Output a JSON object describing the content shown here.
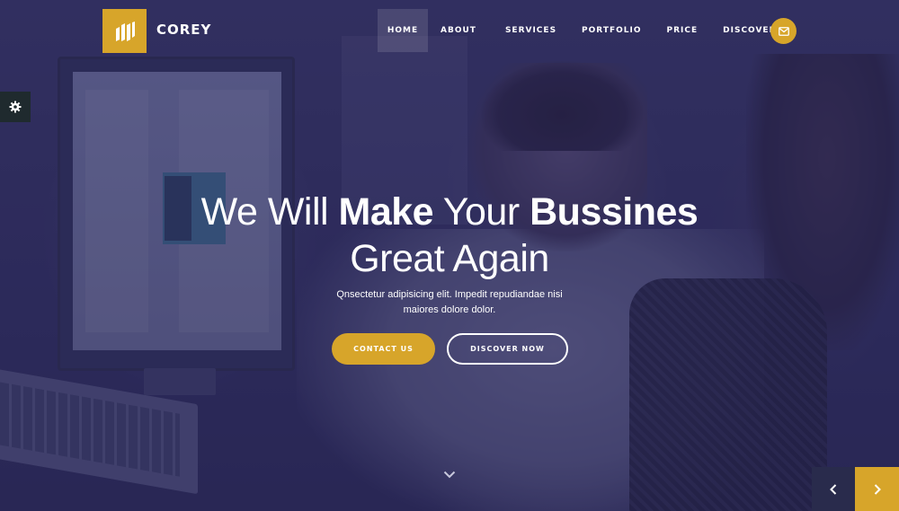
{
  "brand": {
    "name": "COREY",
    "logo_color": "#d7a52a"
  },
  "nav": {
    "items": [
      {
        "label": "HOME",
        "active": true
      },
      {
        "label": "ABOUT",
        "active": false
      },
      {
        "label": "SERVICES",
        "active": false
      },
      {
        "label": "PORTFOLIO",
        "active": false
      },
      {
        "label": "PRICE",
        "active": false
      },
      {
        "label": "DISCOVER",
        "active": false,
        "dropdown": true
      }
    ]
  },
  "hero": {
    "headline_part1": "We Will",
    "headline_bold1": "Make",
    "headline_part2": "Your",
    "headline_bold2": "Bussines",
    "headline_line2": "Great Again",
    "subtext_line1": "Qnsectetur adipisicing elit. Impedit repudiandae nisi",
    "subtext_line2": "maiores dolore dolor.",
    "contact_label": "CONTACT US",
    "discover_label": "DISCOVER NOW"
  },
  "icons": {
    "mail": "envelope-icon",
    "settings": "gear-icon",
    "scroll": "chevron-down-icon",
    "prev": "chevron-left-icon",
    "next": "chevron-right-icon"
  },
  "colors": {
    "accent": "#d7a52a",
    "overlay": "#2c2a55"
  }
}
